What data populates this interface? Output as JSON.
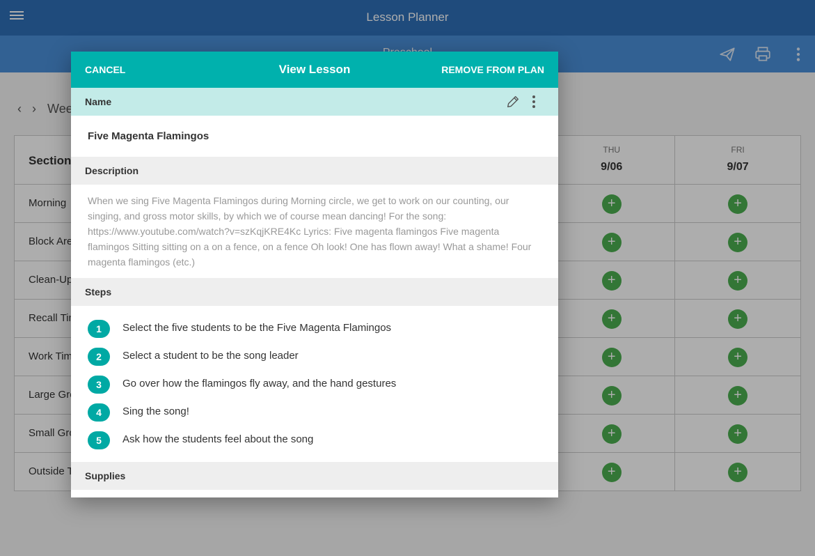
{
  "app": {
    "title": "Lesson Planner"
  },
  "subbar": {
    "title": "Preschool"
  },
  "week_nav": {
    "label": "Week"
  },
  "grid": {
    "section_header": "Sections",
    "days": [
      {
        "name": "THU",
        "date": "9/06"
      },
      {
        "name": "FRI",
        "date": "9/07"
      }
    ],
    "sections": [
      "Morning",
      "Block Area",
      "Clean-Up",
      "Recall Time",
      "Work Time",
      "Large Group",
      "Small Group",
      "Outside Time"
    ],
    "add_symbol": "+"
  },
  "modal": {
    "cancel_label": "CANCEL",
    "title": "View Lesson",
    "remove_label": "REMOVE FROM PLAN",
    "name_heading": "Name",
    "lesson_name": "Five Magenta Flamingos",
    "description_heading": "Description",
    "description": "When we sing Five Magenta Flamingos during Morning circle, we get to work on our counting, our singing, and gross motor skills, by which we of course mean dancing! For the song: https://www.youtube.com/watch?v=szKqjKRE4Kc Lyrics: Five magenta flamingos Five magenta flamingos Sitting sitting on a on a fence, on a fence Oh look! One has flown away! What a shame! Four magenta flamingos (etc.)",
    "steps_heading": "Steps",
    "steps": [
      {
        "num": "1",
        "text": "Select the five students to be the Five Magenta Flamingos"
      },
      {
        "num": "2",
        "text": "Select a student to be the song leader"
      },
      {
        "num": "3",
        "text": "Go over how the flamingos fly away, and the hand gestures"
      },
      {
        "num": "4",
        "text": "Sing the song!"
      },
      {
        "num": "5",
        "text": "Ask how the students feel about the song"
      }
    ],
    "supplies_heading": "Supplies"
  },
  "icons": {
    "menu": "menu-icon",
    "send": "send-icon",
    "print": "print-icon",
    "more": "more-vert-icon",
    "edit": "pencil-icon",
    "prev": "chevron-left-icon",
    "next": "chevron-right-icon"
  },
  "colors": {
    "app_bar": "#2f6fb7",
    "sub_bar": "#4a90d9",
    "modal_header": "#00b1ad",
    "name_section": "#c3ebe8",
    "step_badge": "#00a9a4",
    "add_button": "#4caf50"
  }
}
